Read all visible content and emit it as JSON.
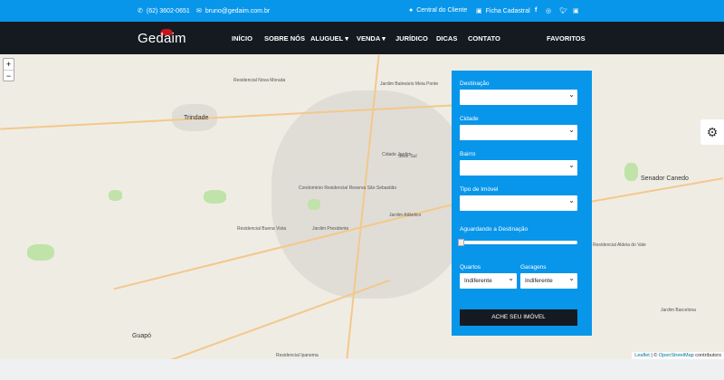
{
  "topbar": {
    "phone": "(62) 3602-0651",
    "email": "bruno@gedaim.com.br",
    "client_area": "Central do Cliente",
    "registration": "Ficha Cadastral"
  },
  "nav": {
    "logo": "Gedaim",
    "items": [
      "INÍCIO",
      "SOBRE NÓS",
      "ALUGUEL",
      "VENDA",
      "JURÍDICO",
      "DICAS",
      "CONTATO"
    ],
    "favorites": "FAVORITOS"
  },
  "map": {
    "zoom_in": "+",
    "zoom_out": "−",
    "labels": [
      "Trindade",
      "Senador Canedo",
      "Guapó",
      "Residencial Nova Morada",
      "Jardim Balneário Meia Ponte",
      "Setor Sul",
      "Residencial Buena Vista",
      "Condomínio Residencial Reserva São Sebastião",
      "Jardim Atlântico",
      "Residencial Aldeia do Vale",
      "Cidade Jardim",
      "Jardim Presidente",
      "Jardim Barcelona",
      "Residencial Ipanema"
    ],
    "attribution": {
      "leaflet": "Leaflet",
      "osm": "OpenStreetMap",
      "suffix": "contributors",
      "sep": " | © "
    }
  },
  "search": {
    "destination_label": "Destinação",
    "city_label": "Cidade",
    "district_label": "Bairro",
    "type_label": "Tipo de Imóvel",
    "slider_label": "Aguardando a Destinação",
    "slider_value": 0,
    "rooms_label": "Quartos",
    "rooms_value": "Indiferente",
    "garages_label": "Garagens",
    "garages_value": "Indiferente",
    "submit": "ACHE SEU IMÓVEL"
  }
}
